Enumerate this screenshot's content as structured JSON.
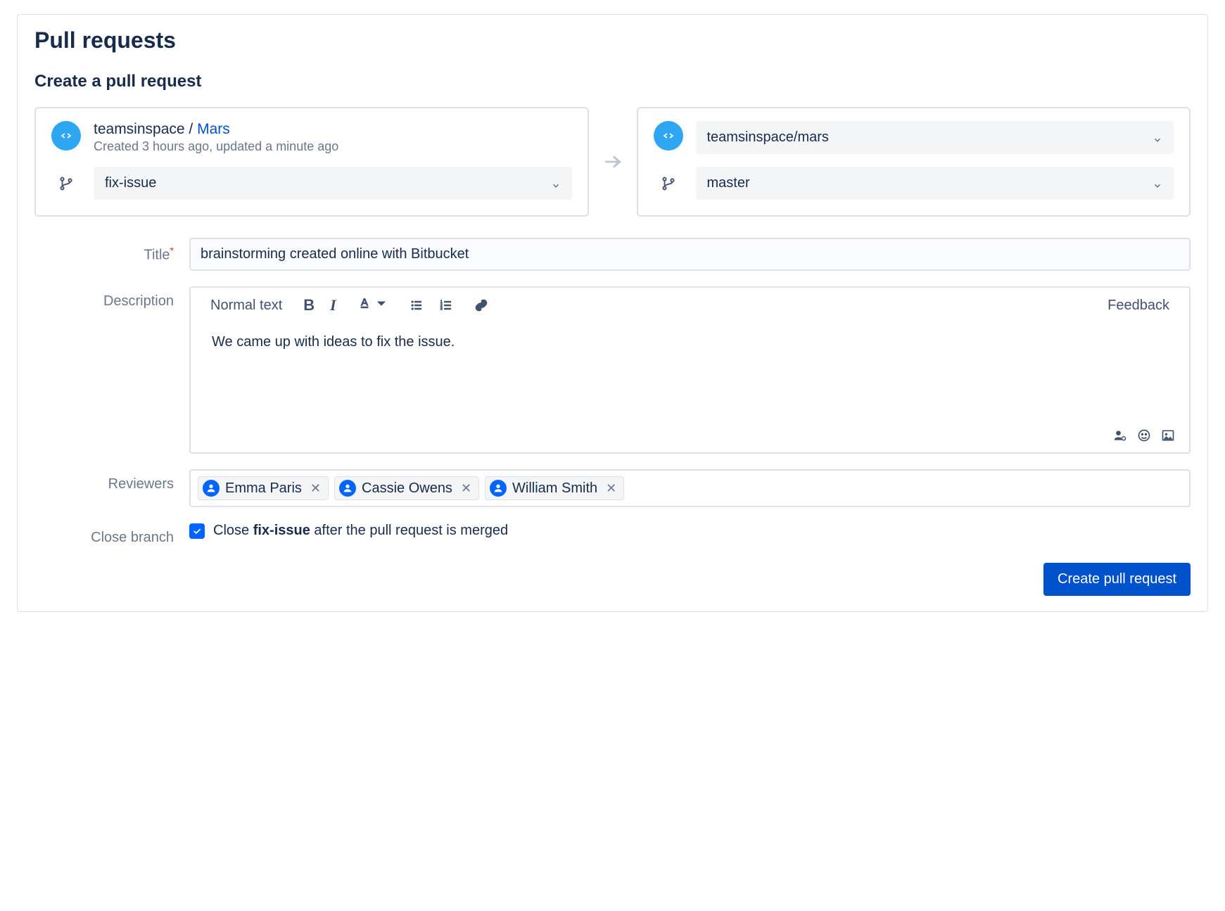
{
  "page": {
    "title": "Pull requests",
    "section": "Create a pull request"
  },
  "source": {
    "repo_owner": "teamsinspace",
    "repo_name": "Mars",
    "meta": "Created 3 hours ago, updated a minute ago",
    "branch": "fix-issue"
  },
  "dest": {
    "repo": "teamsinspace/mars",
    "branch": "master"
  },
  "form": {
    "labels": {
      "title": "Title",
      "description": "Description",
      "reviewers": "Reviewers",
      "close_branch": "Close branch"
    },
    "title_value": "brainstorming created online with Bitbucket",
    "description_value": "We came up with ideas to fix the issue."
  },
  "editor": {
    "style_dropdown": "Normal text",
    "feedback": "Feedback"
  },
  "reviewers": [
    {
      "name": "Emma Paris"
    },
    {
      "name": "Cassie Owens"
    },
    {
      "name": "William Smith"
    }
  ],
  "close_branch": {
    "checked": true,
    "prefix": "Close ",
    "branch": "fix-issue",
    "suffix": " after the pull request is merged"
  },
  "actions": {
    "submit": "Create pull request"
  }
}
